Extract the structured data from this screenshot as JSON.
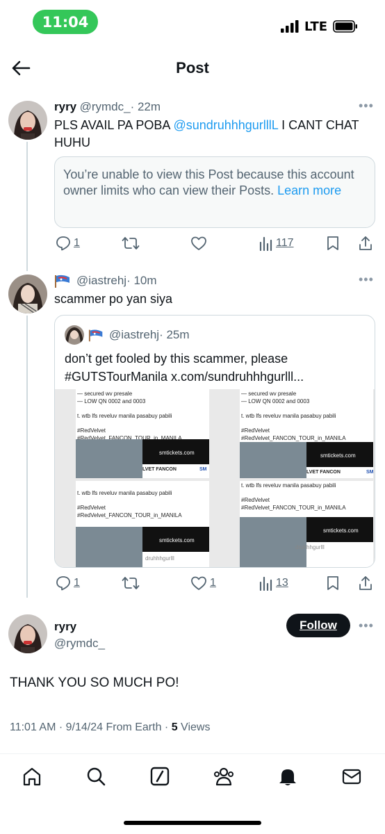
{
  "status_bar": {
    "time": "11:04",
    "network": "LTE"
  },
  "header": {
    "title": "Post"
  },
  "post1": {
    "name": "ryry",
    "handle": "@rymdc_",
    "time": "· 22m",
    "text_before": "PLS AVAIL PA POBA ",
    "mention": "@sundruhhhgurlllL",
    "text_after": " I CANT CHAT HUHU",
    "notice_text": "You’re unable to view this Post because this account owner limits who can view their Posts. ",
    "notice_link": "Learn more",
    "replies": "1",
    "views": "117"
  },
  "post2": {
    "handle": "@iastrehj",
    "time": "· 10m",
    "text": "scammer po yan siya",
    "quote": {
      "handle": "@iastrehj",
      "time": "· 25m",
      "text_line1": "don’t get fooled by this scammer, please",
      "text_line2": "#GUTSTourManila x.com/sundruhhhgurlll...",
      "shot_lines": [
        "— secured wv presale",
        "— LOW QN 0002 and 0003",
        "t. wtb lfs reveluv manila pasabuy pabili",
        "#RedVelvet",
        "#RedVelvet_FANCON_TOUR_in_MANILA"
      ],
      "site": "smtickets.com",
      "fancon": "LVET FANCON",
      "sm": "SM",
      "watermark": "druhhhgurlll"
    },
    "replies": "1",
    "likes": "1",
    "views": "13"
  },
  "main_post": {
    "name": "ryry",
    "handle": "@rymdc_",
    "follow_label": "Follow",
    "text": "THANK YOU SO MUCH PO!",
    "timestamp": "11:01 AM · 9/14/24 From Earth · ",
    "views_count": "5",
    "views_label": " Views"
  },
  "tabs": [
    "home-icon",
    "search-icon",
    "grok-icon",
    "communities-icon",
    "notifications-icon",
    "messages-icon"
  ],
  "colors": {
    "accent": "#1d9bf0",
    "text": "#0f1419",
    "muted": "#536471",
    "status_green": "#34c759"
  }
}
